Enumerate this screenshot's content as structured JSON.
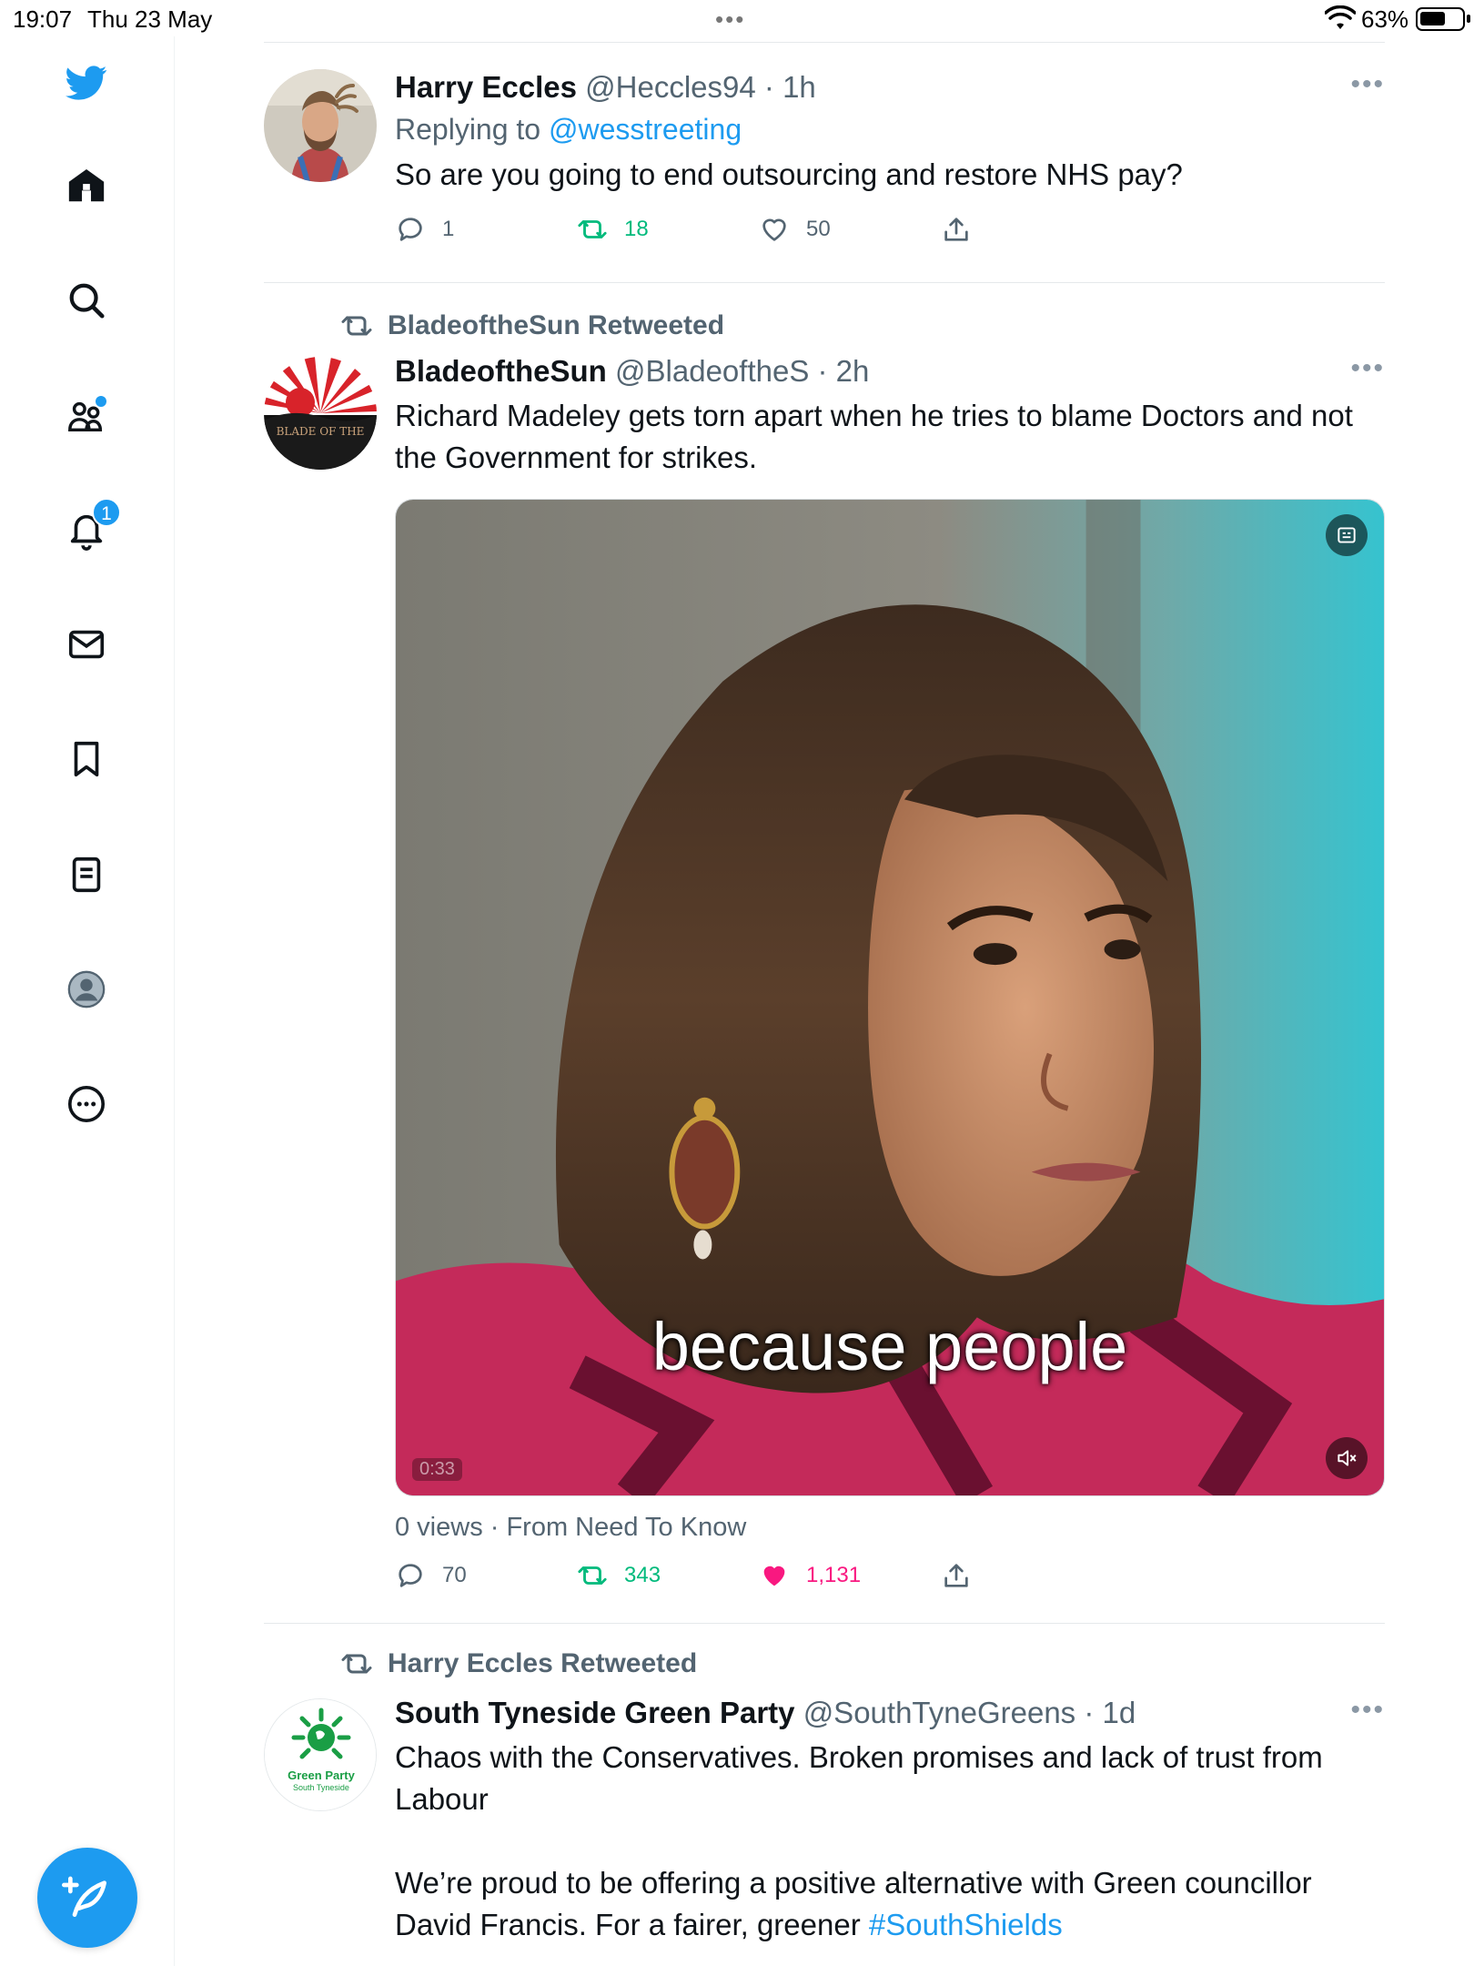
{
  "status_bar": {
    "time": "19:07",
    "date": "Thu 23 May",
    "battery_pct": "63%",
    "battery_level": 0.63
  },
  "sidebar": {
    "items": [
      {
        "name": "twitter-logo-icon"
      },
      {
        "name": "home-icon"
      },
      {
        "name": "explore-search-icon"
      },
      {
        "name": "communities-icon"
      },
      {
        "name": "notifications-icon",
        "badge": "1"
      },
      {
        "name": "messages-icon"
      },
      {
        "name": "bookmarks-icon"
      },
      {
        "name": "lists-icon"
      },
      {
        "name": "profile-icon"
      },
      {
        "name": "more-icon"
      }
    ],
    "compose": {
      "icon": "compose-feather-plus-icon"
    }
  },
  "tweets": [
    {
      "name": "Harry Eccles",
      "handle": "@Heccles94",
      "time": "1h",
      "replying_label": "Replying to",
      "replying_to": "@wesstreeting",
      "text": "So are you going to end outsourcing and restore NHS pay?",
      "replies": "1",
      "retweets": "18",
      "likes": "50"
    },
    {
      "retweeted_by": "BladeoftheSun Retweeted",
      "name": "BladeoftheSun",
      "handle": "@BladeoftheS",
      "time": "2h",
      "text": "Richard Madeley gets torn apart when he tries to blame Doctors and not the Government for strikes.",
      "media_caption": "because people",
      "views": "0 views · From Need To Know",
      "replies": "70",
      "retweets": "343",
      "likes": "1,131",
      "liked": true,
      "avatar_text": "BLADE OF THE"
    },
    {
      "retweeted_by": "Harry Eccles Retweeted",
      "name": "South Tyneside Green Party",
      "handle": "@SouthTyneGreens",
      "time": "1d",
      "text_p1": "Chaos with the Conservatives. Broken promises and lack of trust from Labour",
      "text_p2": "We’re proud to be offering a positive alternative with Green councillor David Francis. For a fairer, greener",
      "hashtag": "#SouthShields",
      "avatar_text_1": "Green Party",
      "avatar_text_2": "South Tyneside"
    }
  ],
  "colors": {
    "accent": "#1d9bf0",
    "retweet": "#00ba7c",
    "like": "#f91880",
    "muted": "#536471"
  }
}
